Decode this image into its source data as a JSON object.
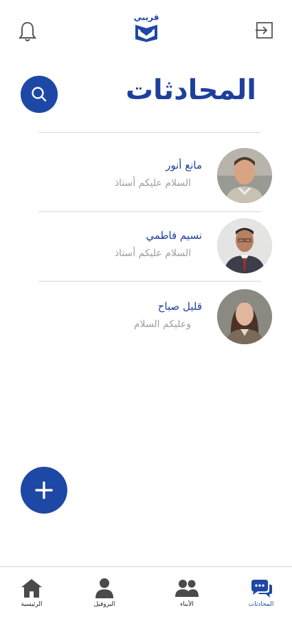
{
  "header": {
    "logo_text": "قريبي",
    "title": "المحادثات"
  },
  "conversations": [
    {
      "name": "مانع أنور",
      "preview": "السلام عليكم أستاذ"
    },
    {
      "name": "نسيم فاطمي",
      "preview": "السلام عليكم أستاذ"
    },
    {
      "name": "قليل صباح",
      "preview": "وعليكم السلام"
    }
  ],
  "icons": {
    "bell": "bell-icon",
    "logout": "logout-icon",
    "search": "search-icon",
    "add": "plus-icon",
    "home": "home-icon",
    "profile": "person-icon",
    "children": "people-icon",
    "chats": "chat-bubbles-icon"
  },
  "colors": {
    "accent": "#1e48a6",
    "text_primary": "#1e3f9c",
    "text_secondary": "#9e9e9e"
  },
  "bottom_nav": {
    "home": "الرئيسية",
    "profile": "البروفيل",
    "children": "الأبناء",
    "chats": "المحادثات",
    "active": "المحادثات"
  }
}
